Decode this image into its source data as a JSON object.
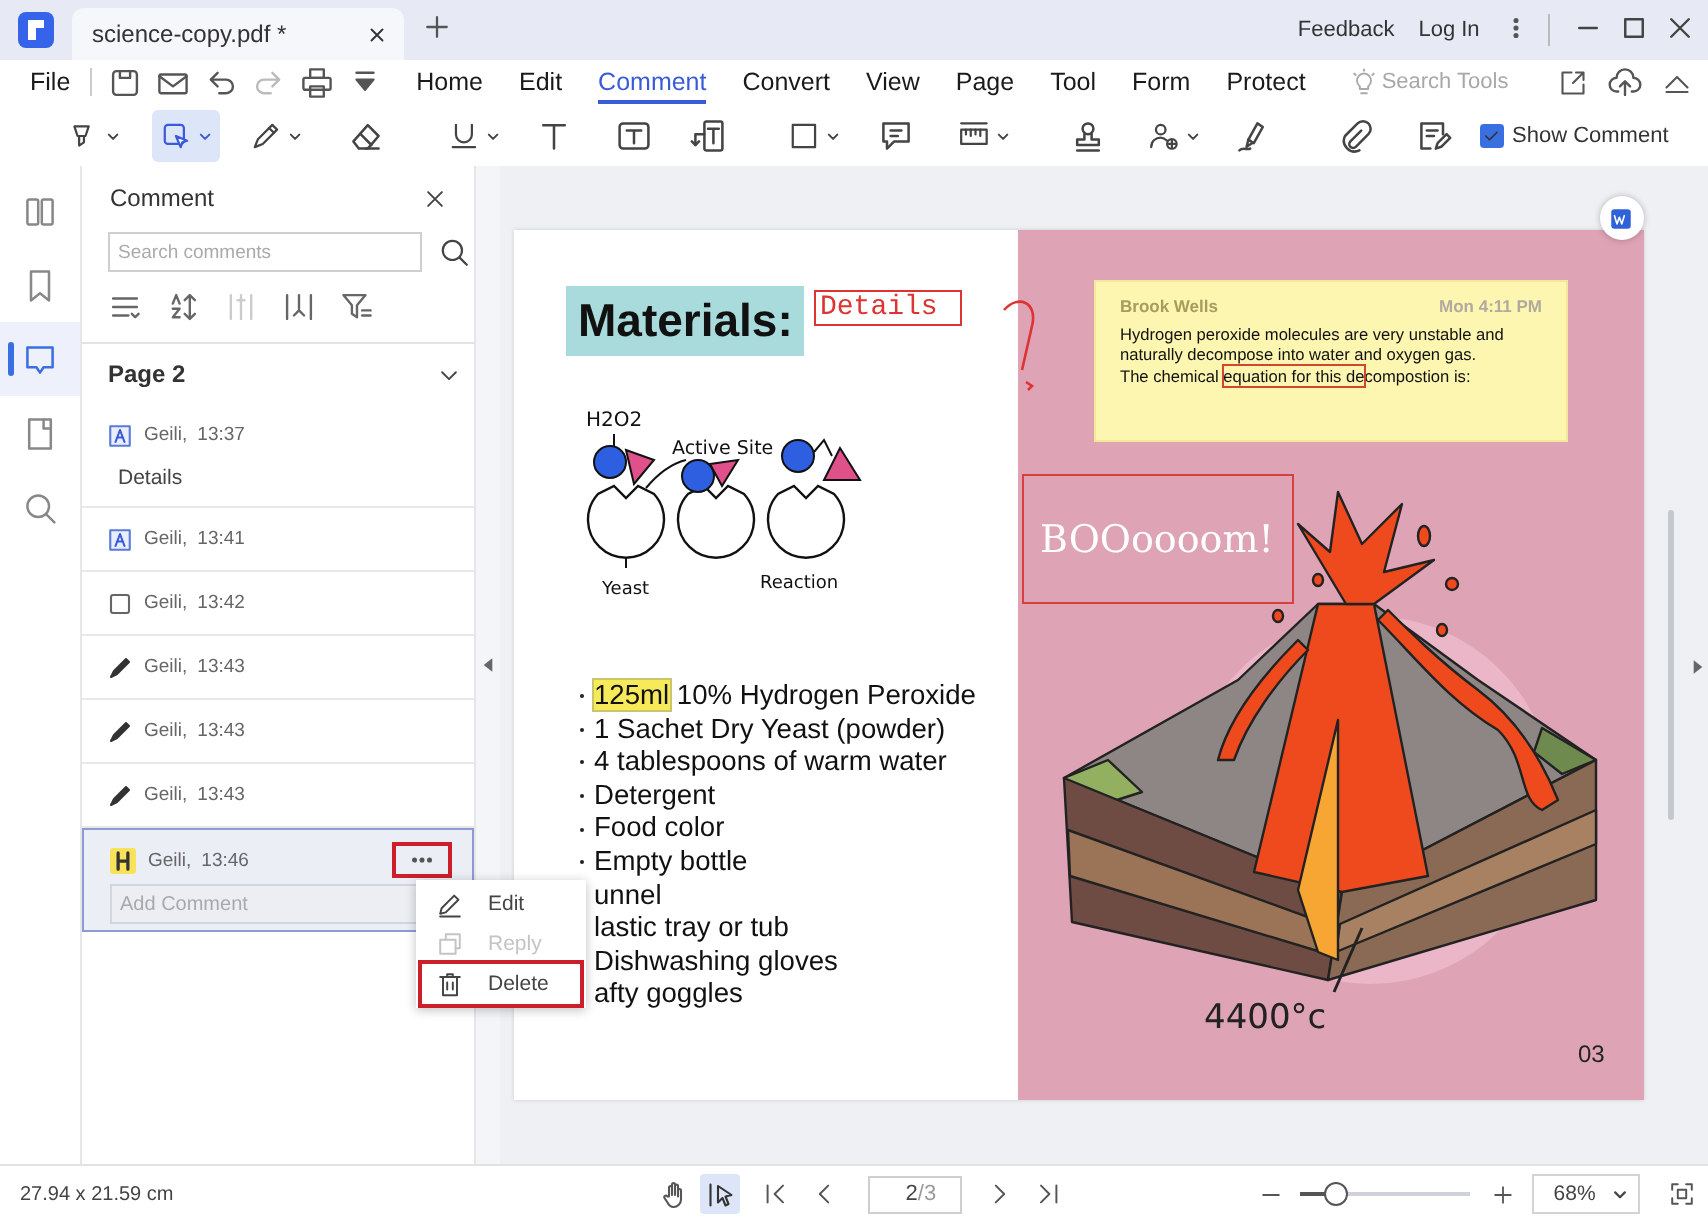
{
  "window": {
    "tab_title": "science-copy.pdf *",
    "links": [
      "Feedback",
      "Log In"
    ]
  },
  "menu": {
    "file": "File",
    "tabs": [
      {
        "label": "Home",
        "selected": false
      },
      {
        "label": "Edit",
        "selected": false
      },
      {
        "label": "Comment",
        "selected": true
      },
      {
        "label": "Convert",
        "selected": false
      },
      {
        "label": "View",
        "selected": false
      },
      {
        "label": "Page",
        "selected": false
      },
      {
        "label": "Tool",
        "selected": false
      },
      {
        "label": "Form",
        "selected": false
      },
      {
        "label": "Protect",
        "selected": false
      }
    ],
    "search": {
      "placeholder": "Search Tools"
    }
  },
  "toolbar": {
    "tools": [
      {
        "dropdown": true,
        "selected": false
      },
      {
        "dropdown": true,
        "selected": true
      },
      {
        "dropdown": true,
        "selected": false
      },
      {
        "dropdown": false,
        "selected": false
      },
      {
        "dropdown": true,
        "selected": false
      },
      {
        "dropdown": false,
        "selected": false
      },
      {
        "dropdown": false,
        "selected": false
      },
      {
        "dropdown": false,
        "selected": false
      },
      {
        "dropdown": true,
        "selected": false
      },
      {
        "dropdown": false,
        "selected": false
      },
      {
        "dropdown": true,
        "selected": false
      },
      {
        "dropdown": false,
        "selected": false
      },
      {
        "dropdown": true,
        "selected": false
      },
      {
        "dropdown": false,
        "selected": false
      },
      {
        "dropdown": false,
        "selected": false
      },
      {
        "dropdown": false,
        "selected": false
      }
    ],
    "show_comment": {
      "label": "Show Comment",
      "checked": true
    }
  },
  "sidebar": {
    "items": [
      {
        "selected": false
      },
      {
        "selected": false
      },
      {
        "selected": true
      },
      {
        "selected": false
      },
      {
        "selected": false
      }
    ]
  },
  "comment_panel": {
    "title": "Comment",
    "search": {
      "placeholder": "Search comments"
    },
    "tools": [
      {
        "disabled": false
      },
      {
        "disabled": false
      },
      {
        "disabled": true
      },
      {
        "disabled": false
      },
      {
        "disabled": false
      }
    ],
    "section": {
      "title": "Page 2",
      "expanded": true
    },
    "comments": [
      {
        "kind": "textbox",
        "author": "Geili,",
        "time": "13:37",
        "text": "Details",
        "selected": false
      },
      {
        "kind": "textbox",
        "author": "Geili,",
        "time": "13:41",
        "selected": false
      },
      {
        "kind": "rectangle",
        "author": "Geili,",
        "time": "13:42",
        "selected": false
      },
      {
        "kind": "pencil",
        "author": "Geili,",
        "time": "13:43",
        "selected": false
      },
      {
        "kind": "pencil",
        "author": "Geili,",
        "time": "13:43",
        "selected": false
      },
      {
        "kind": "pencil",
        "author": "Geili,",
        "time": "13:43",
        "selected": false
      },
      {
        "kind": "highlight",
        "author": "Geili,",
        "time": "13:46",
        "selected": true,
        "more": {
          "outlined": true
        },
        "reply": {
          "placeholder": "Add Comment"
        }
      }
    ]
  },
  "context_menu": {
    "items": [
      {
        "kind": "edit",
        "label": "Edit",
        "disabled": false,
        "outlined": false
      },
      {
        "kind": "reply",
        "label": "Reply",
        "disabled": true,
        "outlined": false
      },
      {
        "kind": "delete",
        "label": "Delete",
        "disabled": false,
        "outlined": true
      }
    ]
  },
  "document": {
    "title": "Materials:",
    "text_annotation": "Details",
    "diagram_labels": [
      "H2O2",
      "Active Site",
      "Yeast",
      "Reaction"
    ],
    "list": [
      {
        "highlight": "125ml",
        "text": "10% Hydrogen Peroxide"
      },
      {
        "text": "1 Sachet Dry Yeast (powder)"
      },
      {
        "text": "4 tablespoons of warm water"
      },
      {
        "text": "Detergent"
      },
      {
        "text": "Food color"
      },
      {
        "text": "Empty bottle"
      },
      {
        "text": "unnel"
      },
      {
        "text": "lastic tray or tub"
      },
      {
        "text": "Dishwashing gloves"
      },
      {
        "text": "afty goggles"
      }
    ],
    "note": {
      "author": "Brook Wells",
      "time": "Mon 4:11 PM",
      "lines": [
        [
          {
            "text": "Hydrogen peroxide molecules are very unstable and",
            "boxed": false
          }
        ],
        [
          {
            "text": "naturally decompose into water and oxygen gas.",
            "boxed": false
          }
        ],
        [
          {
            "text": "The chemical ",
            "boxed": false
          },
          {
            "text": "equation for this de",
            "boxed": true
          },
          {
            "text": "compostion is:",
            "boxed": false
          }
        ]
      ]
    },
    "ink_text": "BOOoooom!",
    "temperature": "4400°c",
    "page_number": "03"
  },
  "status_bar": {
    "dimensions": "27.94 x 21.59 cm",
    "tools": [
      {
        "selected": false
      },
      {
        "selected": true
      }
    ],
    "page": "2",
    "page_count": "/3",
    "zoom": {
      "level": 0.21,
      "value": "68%"
    }
  }
}
